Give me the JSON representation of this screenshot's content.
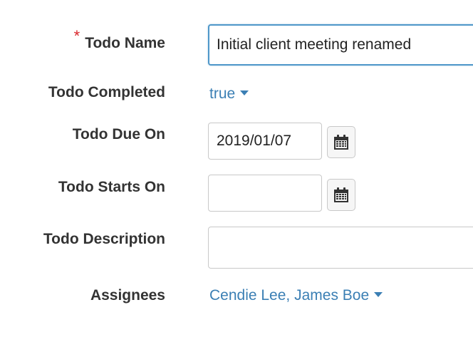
{
  "form": {
    "todo_name": {
      "label": "Todo Name",
      "required_mark": "*",
      "value": "Initial client meeting renamed"
    },
    "todo_completed": {
      "label": "Todo Completed",
      "value": "true"
    },
    "todo_due_on": {
      "label": "Todo Due On",
      "value": "2019/01/07",
      "icon": "calendar-icon"
    },
    "todo_starts_on": {
      "label": "Todo Starts On",
      "value": "",
      "icon": "calendar-icon"
    },
    "todo_description": {
      "label": "Todo Description",
      "value": ""
    },
    "assignees": {
      "label": "Assignees",
      "value": "Cendie Lee, James Boe"
    }
  },
  "colors": {
    "link": "#3b7fb4",
    "required": "#d9262b",
    "focus_border": "#4f97c9"
  }
}
